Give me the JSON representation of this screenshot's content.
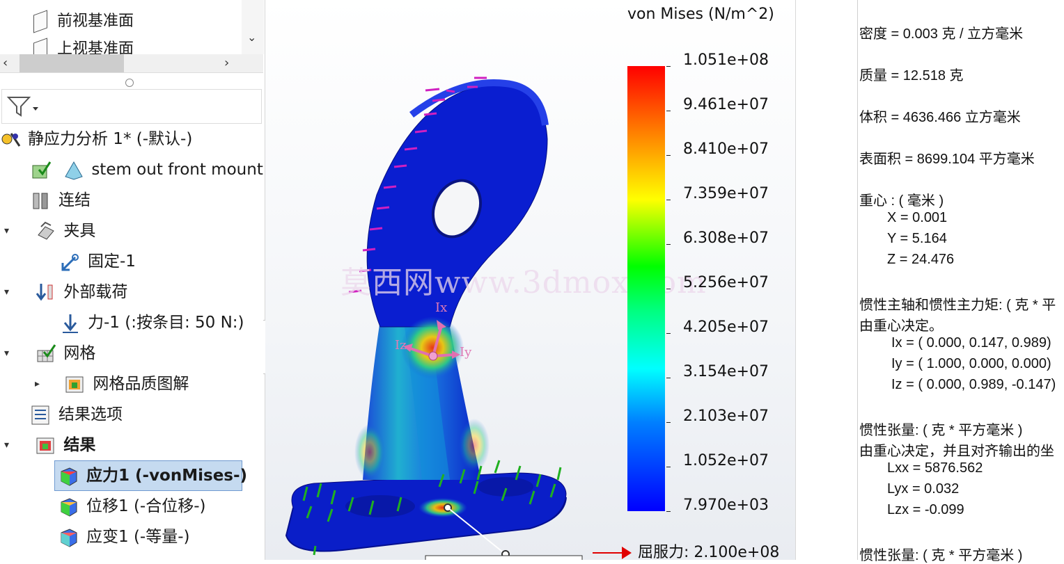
{
  "tree_top": {
    "items": [
      {
        "label": "前视基准面"
      },
      {
        "label": "上视基准面"
      }
    ]
  },
  "study_tree": {
    "study": {
      "label": "静应力分析 1* (-默认-)"
    },
    "part": {
      "label": "stem out front mount (-"
    },
    "connections": {
      "label": "连结"
    },
    "fixtures": {
      "label": "夹具"
    },
    "fixed": {
      "label": "固定-1"
    },
    "external_loads": {
      "label": "外部载荷"
    },
    "force": {
      "label": "力-1 (:按条目: 50 N:)"
    },
    "mesh": {
      "label": "网格"
    },
    "mesh_quality": {
      "label": "网格品质图解"
    },
    "result_options": {
      "label": "结果选项"
    },
    "results": {
      "label": "结果"
    },
    "stress": {
      "label": "应力1 (-vonMises-)"
    },
    "displacement": {
      "label": "位移1 (-合位移-)"
    },
    "strain": {
      "label": "应变1 (-等量-)"
    }
  },
  "legend": {
    "title": "von Mises (N/m^2)",
    "ticks": [
      "1.051e+08",
      "9.461e+07",
      "8.410e+07",
      "7.359e+07",
      "6.308e+07",
      "5.256e+07",
      "4.205e+07",
      "3.154e+07",
      "2.103e+07",
      "1.052e+07",
      "7.970e+03"
    ],
    "yield_label": "屈服力: 2.100e+08",
    "colors": [
      "#ff0000",
      "#ff8000",
      "#ffff00",
      "#00ff00",
      "#00ffff",
      "#0080ff",
      "#0000ff"
    ]
  },
  "viewport": {
    "watermark": "莫西网www.3dmox.com",
    "axes": {
      "ix": "Ix",
      "iy": "Iy",
      "iz": "Iz"
    }
  },
  "mass_properties": {
    "density": "密度 = 0.003 克 / 立方毫米",
    "mass": "质量 = 12.518 克",
    "volume": "体积 = 4636.466 立方毫米",
    "surface_area": "表面积 = 8699.104  平方毫米",
    "cog_title": "重心 : ( 毫米 )",
    "cog_x": "X = 0.001",
    "cog_y": "Y = 5.164",
    "cog_z": "Z = 24.476",
    "principal_title": "惯性主轴和惯性主力矩: ( 克 *  平",
    "principal_sub": "由重心决定。",
    "ix": "Ix = ( 0.000,  0.147,  0.989)",
    "iy": "Iy = ( 1.000,  0.000,  0.000)",
    "iz": "Iz = ( 0.000,  0.989, -0.147)",
    "tensor_title": "惯性张量: ( 克 *  平方毫米 )",
    "tensor_sub": "由重心决定，并且对齐输出的坐",
    "lxx": "Lxx = 5876.562",
    "lyx": "Lyx = 0.032",
    "lzx": "Lzx = -0.099",
    "tensor_title2": "惯性张量: ( 克 *  平方毫米 )"
  }
}
